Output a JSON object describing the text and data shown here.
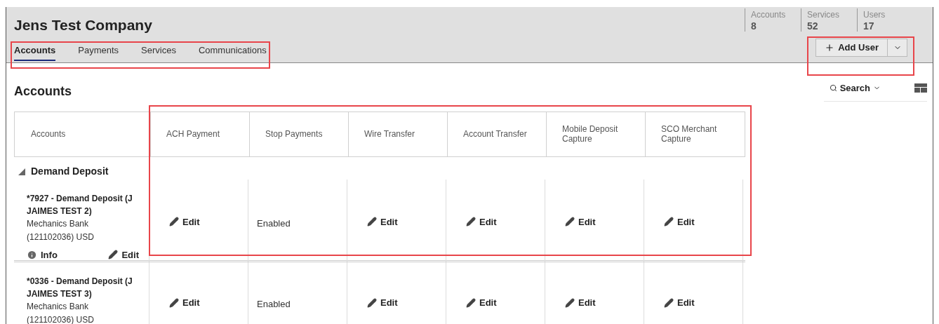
{
  "company": {
    "name": "Jens Test Company"
  },
  "stats": [
    {
      "label": "Accounts",
      "value": "8"
    },
    {
      "label": "Services",
      "value": "52"
    },
    {
      "label": "Users",
      "value": "17"
    }
  ],
  "tabs": [
    {
      "label": "Accounts",
      "selected": true
    },
    {
      "label": "Payments",
      "selected": false
    },
    {
      "label": "Services",
      "selected": false
    },
    {
      "label": "Communications",
      "selected": false
    }
  ],
  "add_user": {
    "label": "Add User"
  },
  "section_title": "Accounts",
  "search": {
    "label": "Search"
  },
  "table": {
    "columns": [
      "Accounts",
      "ACH Payment",
      "Stop Payments",
      "Wire Transfer",
      "Account Transfer",
      "Mobile Deposit Capture",
      "SCO Merchant Capture"
    ],
    "groups": [
      {
        "name": "Demand Deposit",
        "expanded": true,
        "rows": [
          {
            "account": "*7927 - Demand Deposit (J JAIMES TEST 2)",
            "bank": "Mechanics Bank (121102036) USD",
            "info": "Info",
            "edit": "Edit",
            "cells": [
              {
                "kind": "edit",
                "label": "Edit"
              },
              {
                "kind": "text",
                "label": "Enabled"
              },
              {
                "kind": "edit",
                "label": "Edit"
              },
              {
                "kind": "edit",
                "label": "Edit"
              },
              {
                "kind": "edit",
                "label": "Edit"
              },
              {
                "kind": "edit",
                "label": "Edit"
              }
            ]
          },
          {
            "account": "*0336 - Demand Deposit (J JAIMES TEST 3)",
            "bank": "Mechanics Bank (121102036) USD",
            "cells": [
              {
                "kind": "edit",
                "label": "Edit"
              },
              {
                "kind": "text",
                "label": "Enabled"
              },
              {
                "kind": "edit",
                "label": "Edit"
              },
              {
                "kind": "edit",
                "label": "Edit"
              },
              {
                "kind": "edit",
                "label": "Edit"
              },
              {
                "kind": "edit",
                "label": "Edit"
              }
            ]
          }
        ]
      }
    ]
  }
}
